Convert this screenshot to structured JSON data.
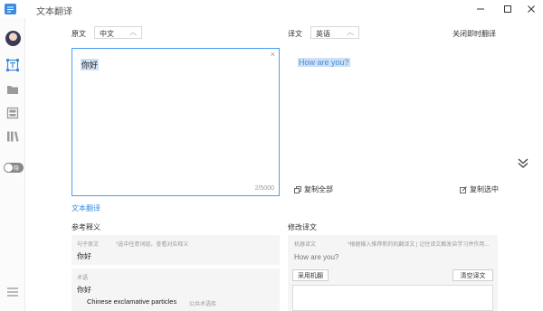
{
  "window": {
    "title": "文本翻译",
    "controls": {
      "minimize": "—",
      "maximize": "☐",
      "close": "✕"
    }
  },
  "sidebar": {
    "items": [
      {
        "name": "avatar"
      },
      {
        "name": "text-translate-icon",
        "active": true
      },
      {
        "name": "folder-icon"
      },
      {
        "name": "image-icon"
      },
      {
        "name": "library-icon"
      }
    ],
    "toggle_label": "隐藏"
  },
  "source": {
    "label": "原文",
    "language": "中文",
    "text": "你好",
    "count": "2/5000",
    "clear": "×"
  },
  "target": {
    "label": "译文",
    "language": "英语",
    "close_instant": "关闭即时翻译",
    "text": "How are you?",
    "copy_all": "复制全部",
    "copy_selected": "复制选中"
  },
  "translate_link": "文本翻译",
  "reference": {
    "title": "参考释义",
    "sentence_label": "句子原文",
    "sentence_hint": "*选中任意词组，查看对应释义",
    "sentence_text": "你好",
    "term_label": "术语",
    "term_word": "你好",
    "term_translation": "Chinese exclamative particles",
    "term_source": "公共术语库"
  },
  "edit": {
    "title": "修改译文",
    "mt_label": "机器译文",
    "mt_hint": "*根据输入推荐新的机翻译文 | 记住译文触发自学习并作用...",
    "mt_text": "How are you?",
    "adopt_button": "采用机翻",
    "clear_button": "清空译文"
  },
  "colors": {
    "accent": "#4d9cf6",
    "link": "#3b8be0",
    "selection": "#cfe0f5",
    "panel_bg": "#f5f5f5"
  }
}
